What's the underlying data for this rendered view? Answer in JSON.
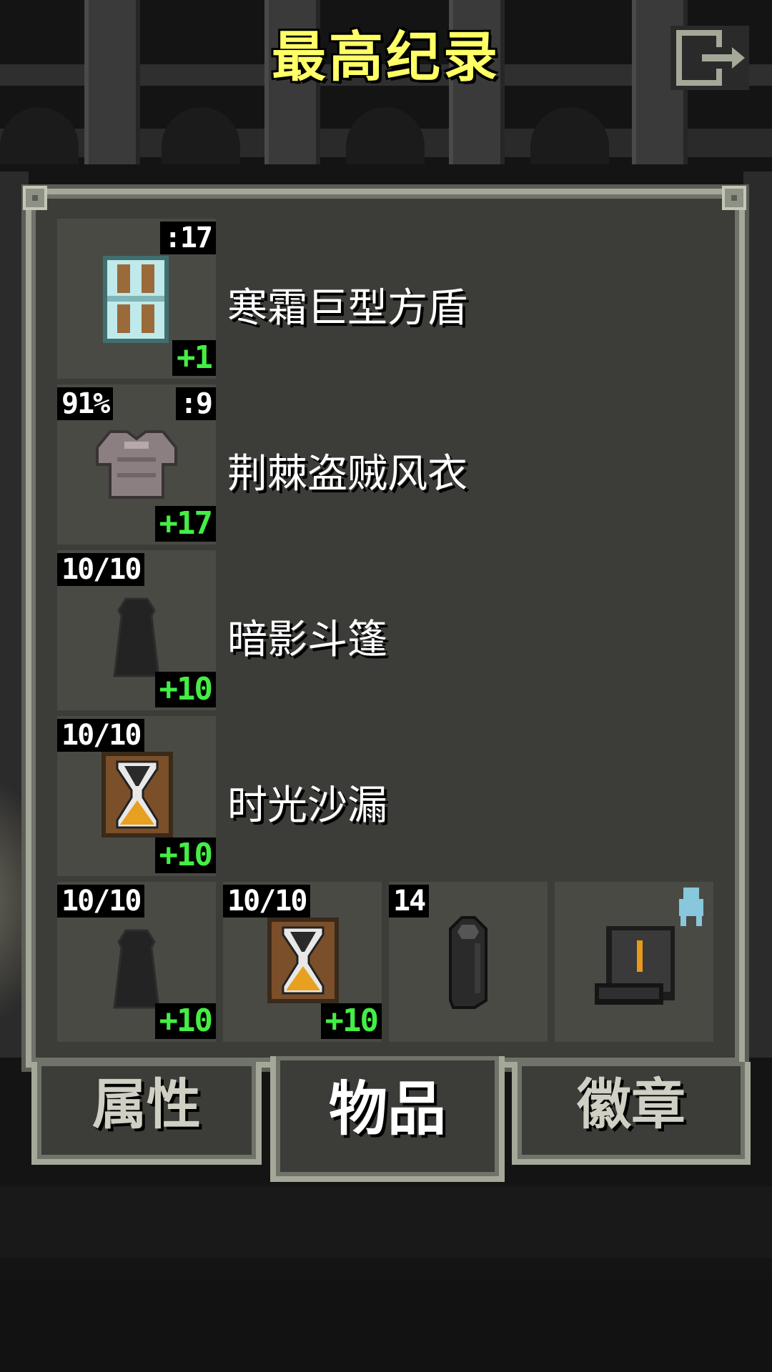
{
  "header": {
    "title": "最高纪录",
    "exit_icon": "exit-door-icon"
  },
  "colors": {
    "title": "#ffff66",
    "bonus": "#44ee44",
    "panel_bg": "#3c3c38",
    "panel_border": "#a4a898"
  },
  "items": [
    {
      "name": "寒霜巨型方盾",
      "level": ":17",
      "bonus": "+1",
      "icon": "frost-tower-shield-icon"
    },
    {
      "name": "荆棘盗贼风衣",
      "level": ":9",
      "charge": "91%",
      "bonus": "+17",
      "icon": "rogue-cloak-armor-icon"
    },
    {
      "name": "暗影斗篷",
      "charge": "10/10",
      "bonus": "+10",
      "icon": "shadow-cloak-icon"
    },
    {
      "name": "时光沙漏",
      "charge": "10/10",
      "bonus": "+10",
      "icon": "hourglass-icon"
    }
  ],
  "quickslots": [
    {
      "charge": "10/10",
      "bonus": "+10",
      "icon": "shadow-cloak-icon"
    },
    {
      "charge": "10/10",
      "bonus": "+10",
      "icon": "hourglass-icon"
    },
    {
      "count": "14",
      "icon": "dark-stone-icon"
    },
    {
      "icon": "tome-chest-icon",
      "badge_icon": "ghost-icon"
    }
  ],
  "tabs": {
    "stats": "属性",
    "items": "物品",
    "badges": "徽章",
    "selected": "items"
  }
}
